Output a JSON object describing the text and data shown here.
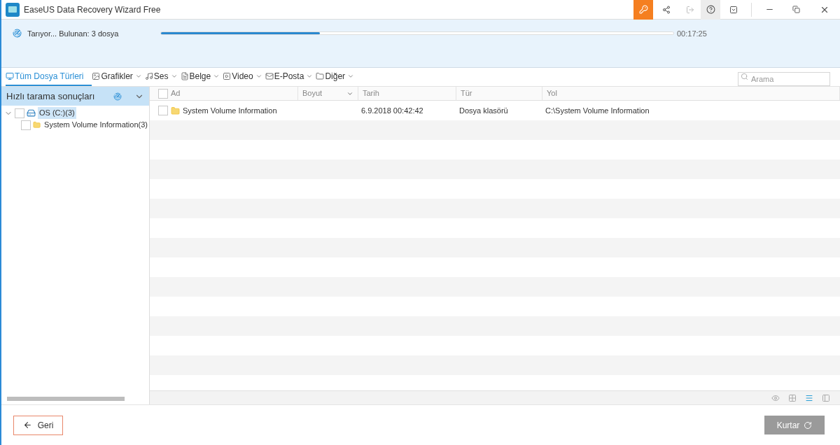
{
  "window": {
    "title": "EaseUS Data Recovery Wizard Free"
  },
  "scan": {
    "status": "Tarıyor... Bulunan: 3 dosya",
    "level": 0.31,
    "time": "00:17:25"
  },
  "file_types": [
    {
      "kind": "monitor",
      "label": "Tüm Dosya Türleri",
      "selected": true
    },
    {
      "kind": "image",
      "label": "Grafikler",
      "selected": false
    },
    {
      "kind": "music",
      "label": "Ses",
      "selected": false
    },
    {
      "kind": "document",
      "label": "Belge",
      "selected": false
    },
    {
      "kind": "video",
      "label": "Video",
      "selected": false
    },
    {
      "kind": "mail",
      "label": "E-Posta",
      "selected": false
    },
    {
      "kind": "folder",
      "label": "Diğer",
      "selected": false
    }
  ],
  "search": {
    "placeholder": "Arama"
  },
  "tree_panel": {
    "title": "Hızlı tarama sonuçları"
  },
  "tree": [
    {
      "label": "OS (C:)(3)",
      "kind": "drive",
      "expanded": true,
      "checked": false,
      "selected": true,
      "children": [
        {
          "label": "System Volume Information(3)",
          "kind": "folder",
          "checked": false,
          "selected": false
        }
      ]
    }
  ],
  "table": {
    "all_checked": false,
    "columns": [
      "Ad",
      "Boyut",
      "Tarih",
      "Tür",
      "Yol"
    ],
    "rows": [
      {
        "name": "System Volume Information",
        "date": "6.9.2018 00:42:42",
        "type": "Dosya klasörü",
        "path": "C:\\System Volume Information",
        "checked": false
      }
    ]
  },
  "view_modes": [
    {
      "kind": "preview",
      "selected": false
    },
    {
      "kind": "grid",
      "selected": false
    },
    {
      "kind": "list",
      "selected": true
    },
    {
      "kind": "detail",
      "selected": false
    }
  ],
  "buttons": {
    "back": {
      "label": "Geri"
    },
    "recover": {
      "label": "Kurtar",
      "disabled": true
    }
  }
}
